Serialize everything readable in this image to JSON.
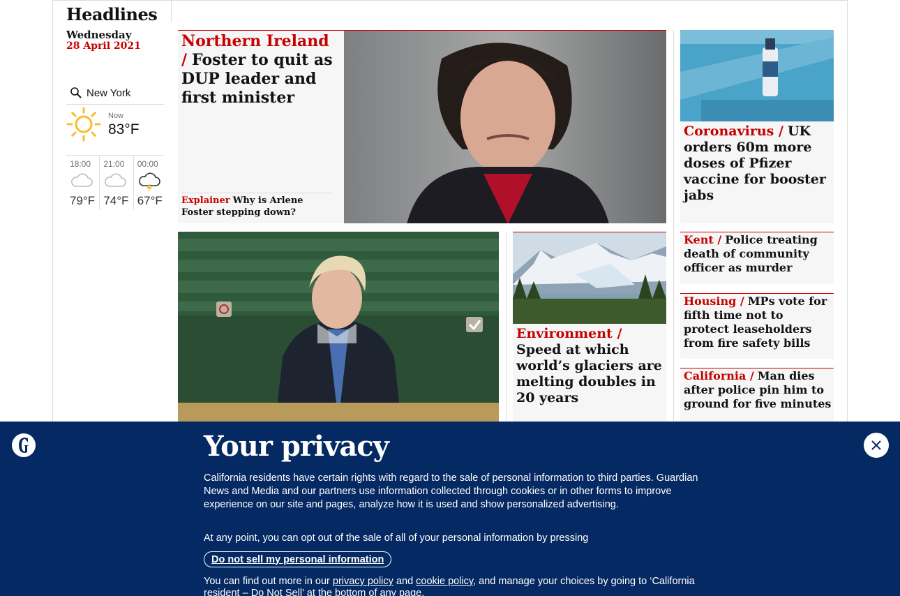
{
  "sidebar": {
    "title": "Headlines",
    "weekday": "Wednesday",
    "date": "28 April 2021"
  },
  "weather": {
    "location": "New York",
    "now_label": "Now",
    "now_temp": "83°F",
    "now_icon": "sun-icon",
    "forecast": [
      {
        "time": "18:00",
        "temp": "79°F",
        "icon": "cloud-icon"
      },
      {
        "time": "21:00",
        "temp": "74°F",
        "icon": "cloud-icon"
      },
      {
        "time": "00:00",
        "temp": "67°F",
        "icon": "thunder-cloud-icon"
      }
    ]
  },
  "stories": {
    "lead": {
      "kicker": "Northern Ireland /",
      "headline": "Foster to quit as DUP leader and first minister",
      "sub_kicker": "Explainer",
      "sub_headline": "Why is Arlene Foster stepping down?"
    },
    "covid": {
      "kicker": "Coronavirus /",
      "headline": "UK orders 60m more doses of Pfizer vaccine for booster jabs"
    },
    "environment": {
      "kicker": "Environment /",
      "headline": "Speed at which world’s glaciers are melting doubles in 20 years"
    },
    "kent": {
      "kicker": "Kent /",
      "headline": "Police treating death of community officer as murder"
    },
    "housing": {
      "kicker": "Housing /",
      "headline": "MPs vote for fifth time not to protect leaseholders from fire safety bills"
    },
    "california": {
      "kicker": "California /",
      "headline": "Man dies after police pin him to ground for five minutes"
    }
  },
  "privacy": {
    "title": "Your privacy",
    "body1": "California residents have certain rights with regard to the sale of personal information to third parties. Guardian News and Media and our partners use information collected through cookies or in other forms to improve experience on our site and pages, analyze how it is used and show personalized advertising.",
    "body2": "At any point, you can opt out of the sale of all of your personal information by pressing",
    "button": "Do not sell my personal information",
    "body3_a": "You can find out more in our",
    "privacy_link": "privacy policy",
    "and": "and",
    "cookie_link": "cookie policy",
    "body3_b": ", and manage your choices by going to ‘California resident – Do Not Sell’ at the bottom of any page."
  },
  "colors": {
    "accent": "#c70000",
    "banner": "#052962",
    "sun": "#f5be2c"
  }
}
